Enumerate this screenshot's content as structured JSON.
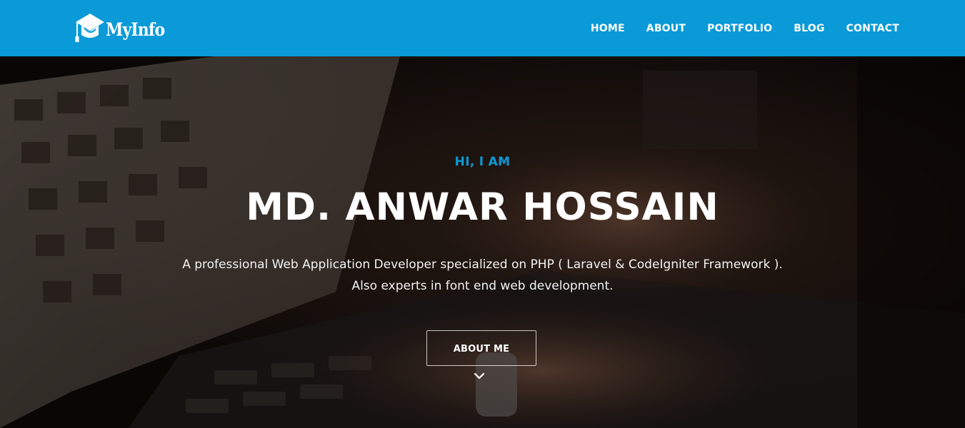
{
  "brand": {
    "logo_text": "MyInfo",
    "logo_icon": "graduation-cap-icon",
    "accent_color": "#0a9ad7"
  },
  "nav": {
    "items": [
      {
        "label": "HOME"
      },
      {
        "label": "ABOUT"
      },
      {
        "label": "PORTFOLIO"
      },
      {
        "label": "BLOG"
      },
      {
        "label": "CONTACT"
      }
    ]
  },
  "hero": {
    "eyebrow": "HI, I AM",
    "title": "MD. ANWAR HOSSAIN",
    "description_lines": [
      "A professional Web Application Developer specialized on PHP ( Laravel & CodeIgniter Framework ).",
      "Also experts in font end web development."
    ],
    "cta_label": "ABOUT ME",
    "scroll_icon": "chevron-down-icon",
    "background_image": "hands typing on laptop keyboard"
  }
}
